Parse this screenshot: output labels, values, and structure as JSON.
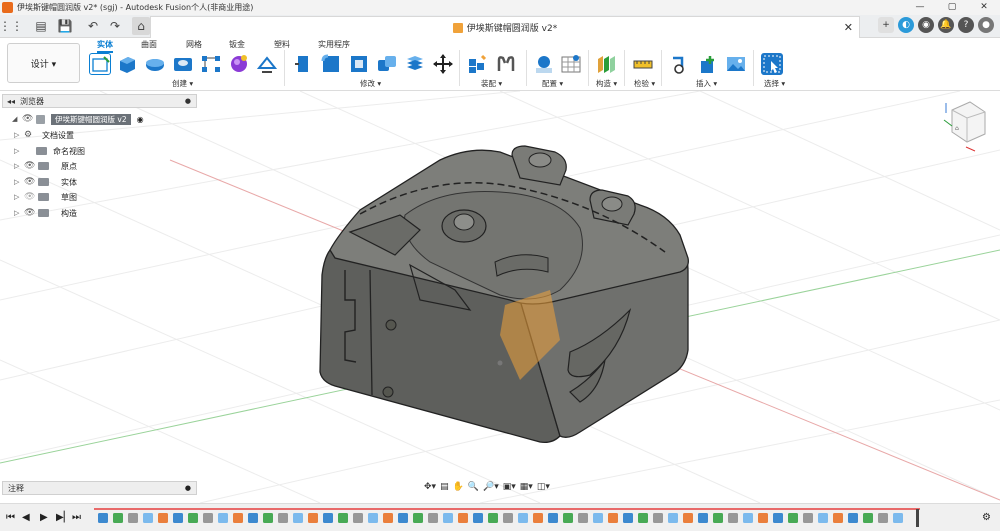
{
  "window": {
    "title": "伊埃斯键帽圆润版 v2* (sgj) - Autodesk Fusion个人(非商业用途)",
    "controls": [
      "—",
      "▢",
      "✕"
    ]
  },
  "doc_tab": {
    "label": "伊埃斯键帽圆润版 v2*"
  },
  "workspace": {
    "label": "设计 ▾"
  },
  "ribbon": {
    "tabs": [
      "实体",
      "曲面",
      "网格",
      "钣金",
      "塑料",
      "实用程序"
    ],
    "groups": [
      "创建 ▾",
      "修改 ▾",
      "装配 ▾",
      "配置 ▾",
      "构造 ▾",
      "检验 ▾",
      "插入 ▾",
      "选择 ▾"
    ]
  },
  "browser": {
    "title": "浏览器",
    "root": "伊埃斯键帽圆润版 v2",
    "items": [
      {
        "label": "文档设置",
        "icon": "gear-icon"
      },
      {
        "label": "命名视图",
        "icon": "folder-icon"
      },
      {
        "label": "原点",
        "icon": "folder-icon"
      },
      {
        "label": "实体",
        "icon": "folder-icon"
      },
      {
        "label": "草图",
        "icon": "folder-icon"
      },
      {
        "label": "构造",
        "icon": "folder-icon"
      }
    ]
  },
  "comments": {
    "title": "注释"
  },
  "colors": {
    "accent": "#0a7fd3",
    "model": "#6e6f6c",
    "highlight": "#f0a23a"
  }
}
